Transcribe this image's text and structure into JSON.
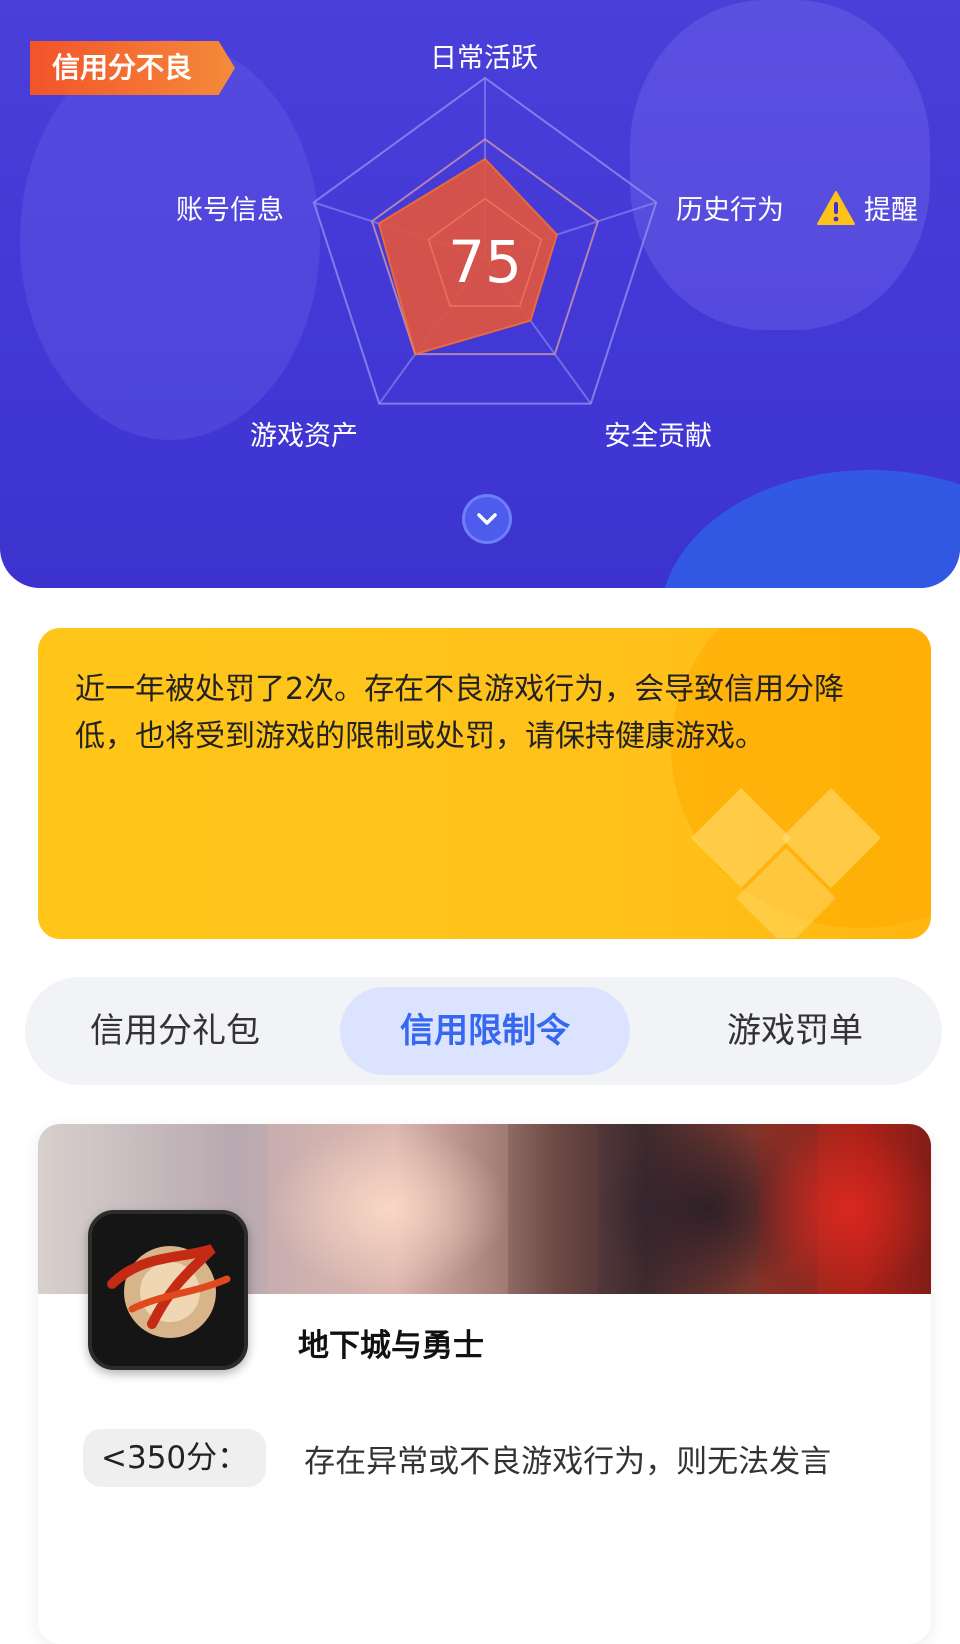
{
  "header": {
    "status_tag": "信用分不良",
    "score": "75",
    "remind_label": "提醒",
    "radar": {
      "axes": [
        "日常活跃",
        "历史行为",
        "安全贡献",
        "游戏资产",
        "账号信息"
      ],
      "values": [
        0.55,
        0.42,
        0.43,
        0.66,
        0.62
      ],
      "grid_color": "#8f8ff0",
      "fill_color": "#e0553f"
    }
  },
  "notice": {
    "text": "近一年被处罚了2次。存在不良游戏行为，会导致信用分降低，也将受到游戏的限制或处罚，请保持健康游戏。"
  },
  "tabs": {
    "items": [
      {
        "label": "信用分礼包"
      },
      {
        "label": "信用限制令"
      },
      {
        "label": "游戏罚单"
      }
    ],
    "active_index": 1
  },
  "game_card": {
    "name": "地下城与勇士",
    "rule_badge": "<350分：",
    "rule_text": "存在异常或不良游戏行为，则无法发言"
  },
  "colors": {
    "hero_bg": "#4338d6",
    "tag_gradient_start": "#f2542a",
    "notice_bg": "#ffc619",
    "active_tab_bg": "#dbe3ff",
    "active_tab_text": "#3567f0"
  }
}
